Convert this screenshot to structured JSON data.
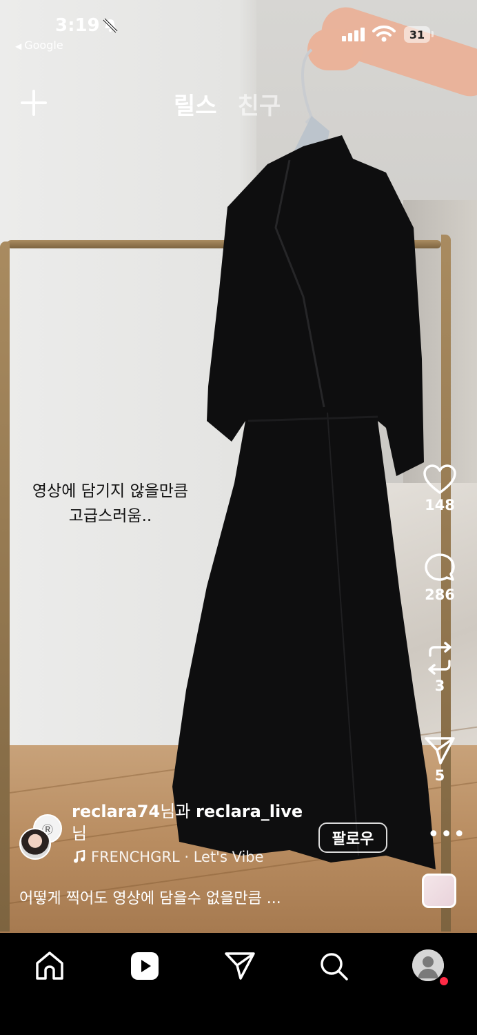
{
  "status_bar": {
    "time": "3:19",
    "back_app": "Google",
    "battery": "31"
  },
  "header": {
    "tabs": [
      {
        "label": "릴스",
        "active": true
      },
      {
        "label": "친구",
        "active": false
      }
    ],
    "plus_icon": "plus-icon"
  },
  "video": {
    "overlay_caption_line1": "영상에 담기지 않을만큼",
    "overlay_caption_line2": "고급스러움.."
  },
  "actions": {
    "likes": "148",
    "comments": "286",
    "reposts": "3",
    "shares": "5"
  },
  "post": {
    "user1": "reclara74",
    "joiner": "님과 ",
    "user2": "reclara_live",
    "suffix": "님",
    "follow_label": "팔로우",
    "music": "FRENCHGRL · Let's Vibe",
    "description": "어떻게 찍어도 영상에 담을수 없을만큼 ..."
  },
  "nav": {
    "items": [
      "home-icon",
      "reels-icon",
      "send-icon",
      "search-icon",
      "profile-avatar"
    ]
  },
  "colors": {
    "nav_background": "#000000",
    "notification_dot": "#ff2a45",
    "text_on_video": "#ffffff"
  }
}
